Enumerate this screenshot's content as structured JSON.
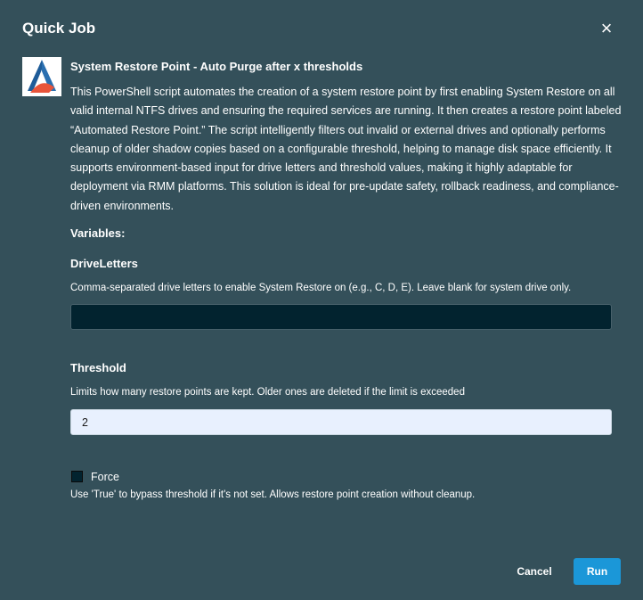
{
  "modal": {
    "title": "Quick Job",
    "close_label": "×"
  },
  "script": {
    "logo_icon": "deploy-logo-icon",
    "title": "System Restore Point - Auto Purge after x thresholds",
    "description": "This PowerShell script automates the creation of a system restore point by first enabling System Restore on all valid internal NTFS drives and ensuring the required services are running. It then creates a restore point labeled “Automated Restore Point.” The script intelligently filters out invalid or external drives and optionally performs cleanup of older shadow copies based on a configurable threshold, helping to manage disk space efficiently. It supports environment-based input for drive letters and threshold values, making it highly adaptable for deployment via RMM platforms. This solution is ideal for pre-update safety, rollback readiness, and compliance-driven environments."
  },
  "variables": {
    "heading": "Variables:",
    "drive_letters": {
      "label": "DriveLetters",
      "help": "Comma-separated drive letters to enable System Restore on (e.g., C, D, E). Leave blank for system drive only.",
      "value": ""
    },
    "threshold": {
      "label": "Threshold",
      "help": "Limits how many restore points are kept. Older ones are deleted if the limit is exceeded",
      "value": "2"
    },
    "force": {
      "label": "Force",
      "checked": false,
      "help": "Use 'True' to bypass threshold if it's not set. Allows restore point creation without cleanup."
    }
  },
  "actions": {
    "cancel_label": "Cancel",
    "run_label": "Run"
  },
  "colors": {
    "background": "#34505a",
    "input_dark": "#02232f",
    "input_light": "#e8f0fe",
    "run_button": "#1b97d8",
    "logo_blue": "#1e5c99",
    "logo_orange": "#e8543a"
  }
}
